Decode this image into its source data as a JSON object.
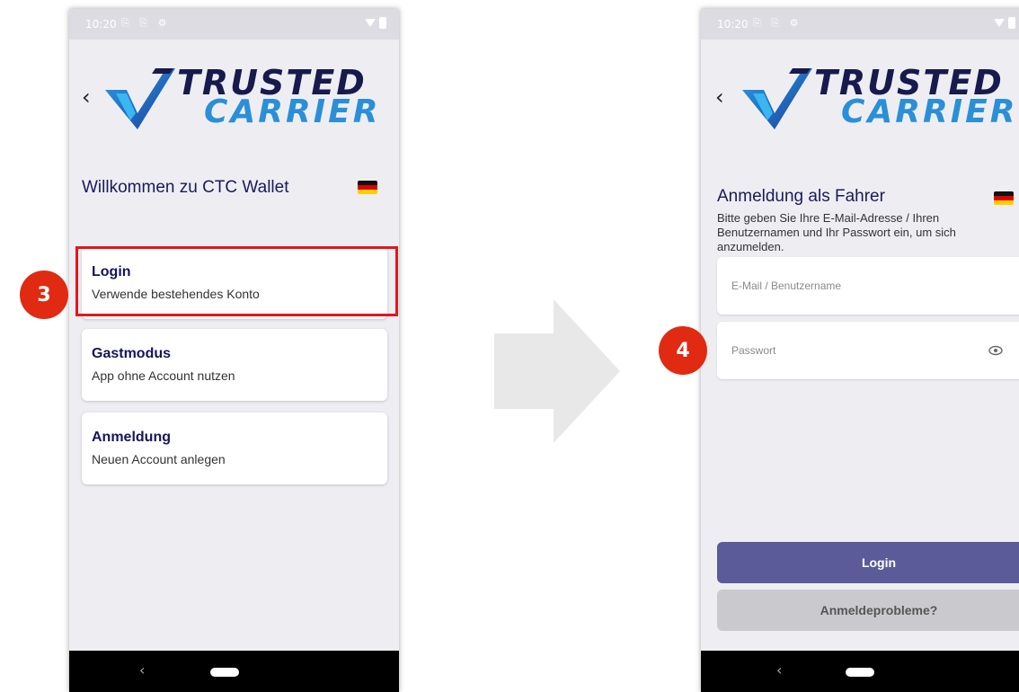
{
  "colors": {
    "accent": "#5b5b9a",
    "title_navy": "#15155a",
    "highlight_red": "#e8141c",
    "badge_red": "#e02a12",
    "logo_navy": "#181a4e",
    "logo_blue": "#2b8fd8"
  },
  "status_bar": {
    "time": "10:20",
    "left_icons": "⎘ ⎘ ⚙"
  },
  "logo": {
    "word1": "TRUSTED",
    "word2": "CARRIER"
  },
  "left_screen": {
    "title": "Willkommen zu CTC Wallet",
    "language_flag": "de-flag-icon",
    "cards": [
      {
        "title": "Login",
        "subtitle": "Verwende bestehendes Konto"
      },
      {
        "title": "Gastmodus",
        "subtitle": "App ohne Account nutzen"
      },
      {
        "title": "Anmeldung",
        "subtitle": "Neuen Account anlegen"
      }
    ]
  },
  "right_screen": {
    "title": "Anmeldung als Fahrer",
    "description": "Bitte geben Sie Ihre E-Mail-Adresse / Ihren Benutzernamen und Ihr Passwort ein, um sich anzumelden.",
    "email_placeholder": "E-Mail / Benutzername",
    "password_placeholder": "Passwort",
    "login_button": "Login",
    "problems_button": "Anmeldeprobleme?"
  },
  "annotations": {
    "step3": "3",
    "step4": "4"
  },
  "nav": {
    "back_glyph": "‹"
  }
}
